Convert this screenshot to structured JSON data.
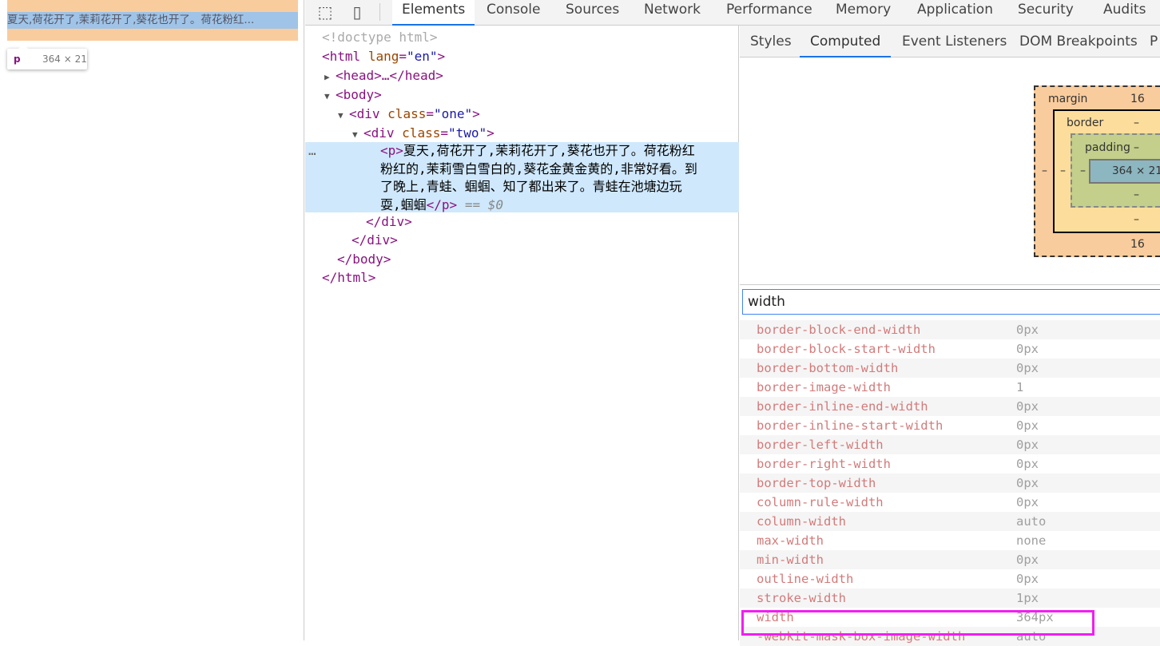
{
  "page": {
    "paragraph_truncated": "夏天,荷花开了,茉莉花开了,葵花也开了。荷花粉红...",
    "tooltip_tag": "p",
    "tooltip_size": "364 × 21"
  },
  "toolbar": {
    "tabs": [
      "Elements",
      "Console",
      "Sources",
      "Network",
      "Performance",
      "Memory",
      "Application",
      "Security",
      "Audits"
    ],
    "active": "Elements"
  },
  "tree": {
    "doctype": "<!doctype html>",
    "html_open": "<html",
    "lang_attr": "lang",
    "lang_val": "\"en\"",
    "head": "<head>…</head>",
    "body_open": "<body>",
    "div_one": "<div",
    "class_attr": "class",
    "one_val": "\"one\"",
    "two_val": "\"two\"",
    "p_open": "<p>",
    "p_lines": [
      "夏天,荷花开了,茉莉花开了,葵花也开了。荷花粉红",
      "粉红的,茉莉雪白雪白的,葵花金黄金黄的,非常好看。到",
      "了晚上,青蛙、蝈蝈、知了都出来了。青蛙在池塘边玩",
      "耍,蝈蝈"
    ],
    "p_close": "</p>",
    "selected_marker": "== $0",
    "dots": "…",
    "div_close": "</div>",
    "body_close": "</body>",
    "html_close": "</html>",
    "gt": ">"
  },
  "sidebar": {
    "tabs": [
      "Styles",
      "Computed",
      "Event Listeners",
      "DOM Breakpoints",
      "P"
    ],
    "active": "Computed"
  },
  "box_model": {
    "margin_label": "margin",
    "margin_top": "16",
    "margin_bottom": "16",
    "margin_left": "–",
    "border_label": "border",
    "border_top": "–",
    "border_bottom": "–",
    "border_left": "–",
    "padding_label": "padding",
    "padding_top": "–",
    "padding_bottom": "–",
    "padding_left": "–",
    "content": "364 × 21"
  },
  "filter": {
    "value": "width"
  },
  "computed": [
    {
      "name": "border-block-end-width",
      "value": "0px"
    },
    {
      "name": "border-block-start-width",
      "value": "0px"
    },
    {
      "name": "border-bottom-width",
      "value": "0px"
    },
    {
      "name": "border-image-width",
      "value": "1"
    },
    {
      "name": "border-inline-end-width",
      "value": "0px"
    },
    {
      "name": "border-inline-start-width",
      "value": "0px"
    },
    {
      "name": "border-left-width",
      "value": "0px"
    },
    {
      "name": "border-right-width",
      "value": "0px"
    },
    {
      "name": "border-top-width",
      "value": "0px"
    },
    {
      "name": "column-rule-width",
      "value": "0px"
    },
    {
      "name": "column-width",
      "value": "auto"
    },
    {
      "name": "max-width",
      "value": "none"
    },
    {
      "name": "min-width",
      "value": "0px"
    },
    {
      "name": "outline-width",
      "value": "0px"
    },
    {
      "name": "stroke-width",
      "value": "1px"
    },
    {
      "name": "width",
      "value": "364px"
    },
    {
      "name": "-webkit-mask-box-image-width",
      "value": "auto"
    }
  ],
  "highlight_color": "#f11ef1"
}
